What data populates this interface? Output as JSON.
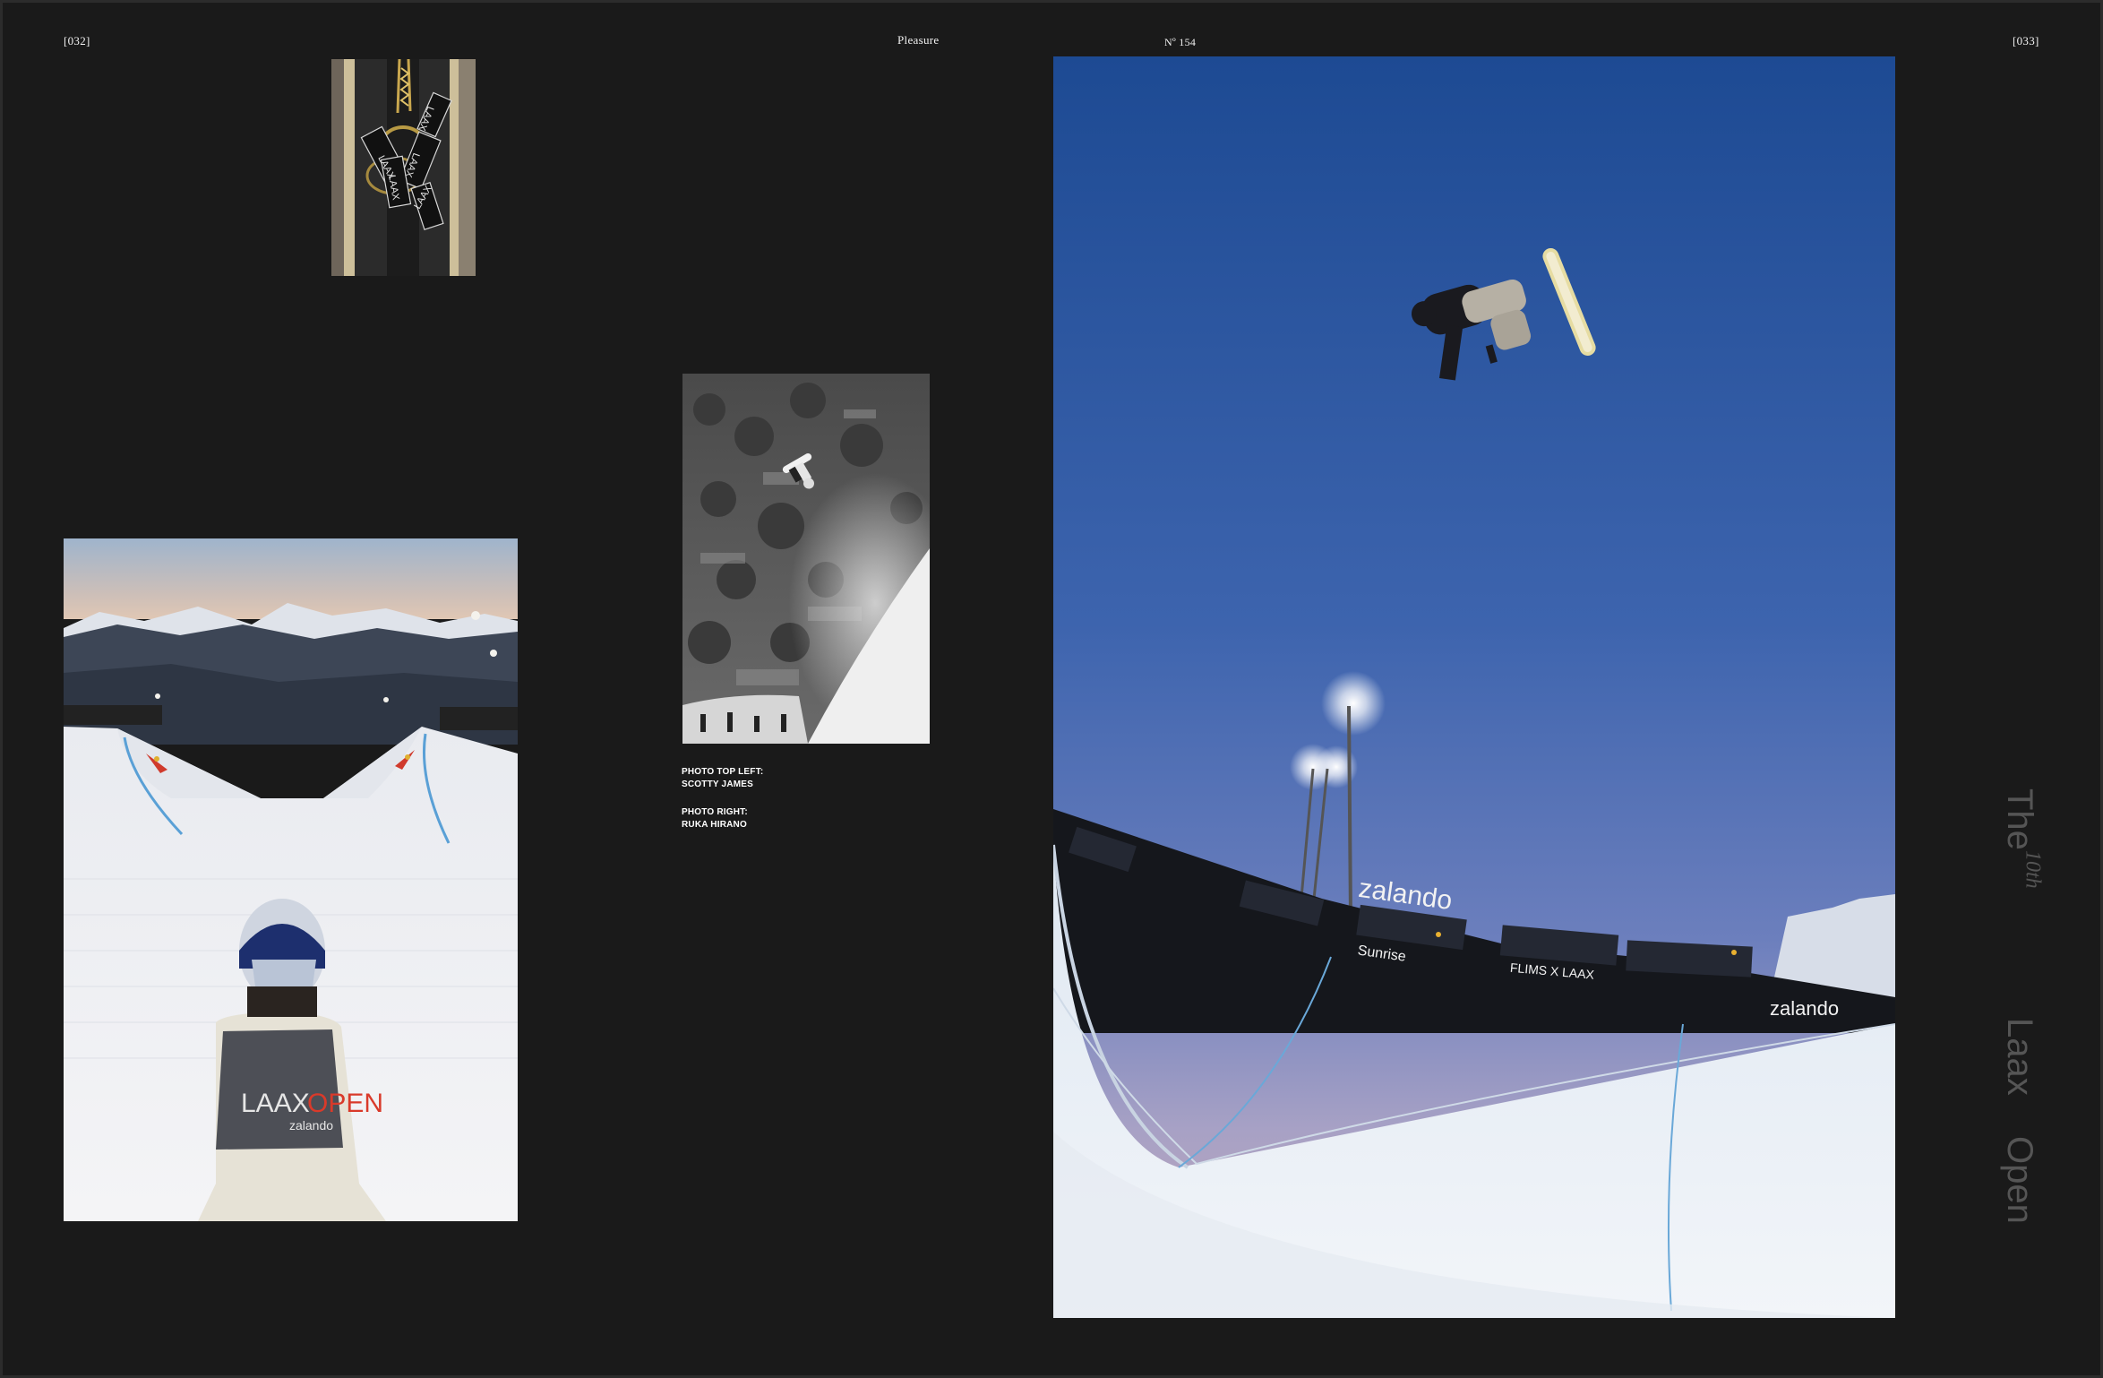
{
  "header": {
    "page_left": "[032]",
    "section": "Pleasure",
    "issue": "Nº 154",
    "page_right": "[033]"
  },
  "captions": {
    "top_left_label": "PHOTO TOP LEFT:",
    "top_left_name": "SCOTTY JAMES",
    "right_label": "PHOTO RIGHT:",
    "right_name": "RUKA HIRANO"
  },
  "vertical_title": {
    "the": "The",
    "ordinal_number": "10",
    "ordinal_suffix": "th",
    "laax": "Laax",
    "open": "Open"
  },
  "photo_text": {
    "tag_text": "LAAX",
    "bib_brand_a": "LAAX",
    "bib_brand_b": "OPEN",
    "bib_sponsor": "zalando",
    "banner_brand": "zalando",
    "banner_sunrise": "Sunrise",
    "banner_flims": "FLIMS X LAAX"
  },
  "colors": {
    "background": "#1a1a1a",
    "sky_top": "#1f4f9a",
    "sky_bottom": "#a6a0c4",
    "snow": "#e9edf2",
    "title_grey": "#555555"
  }
}
